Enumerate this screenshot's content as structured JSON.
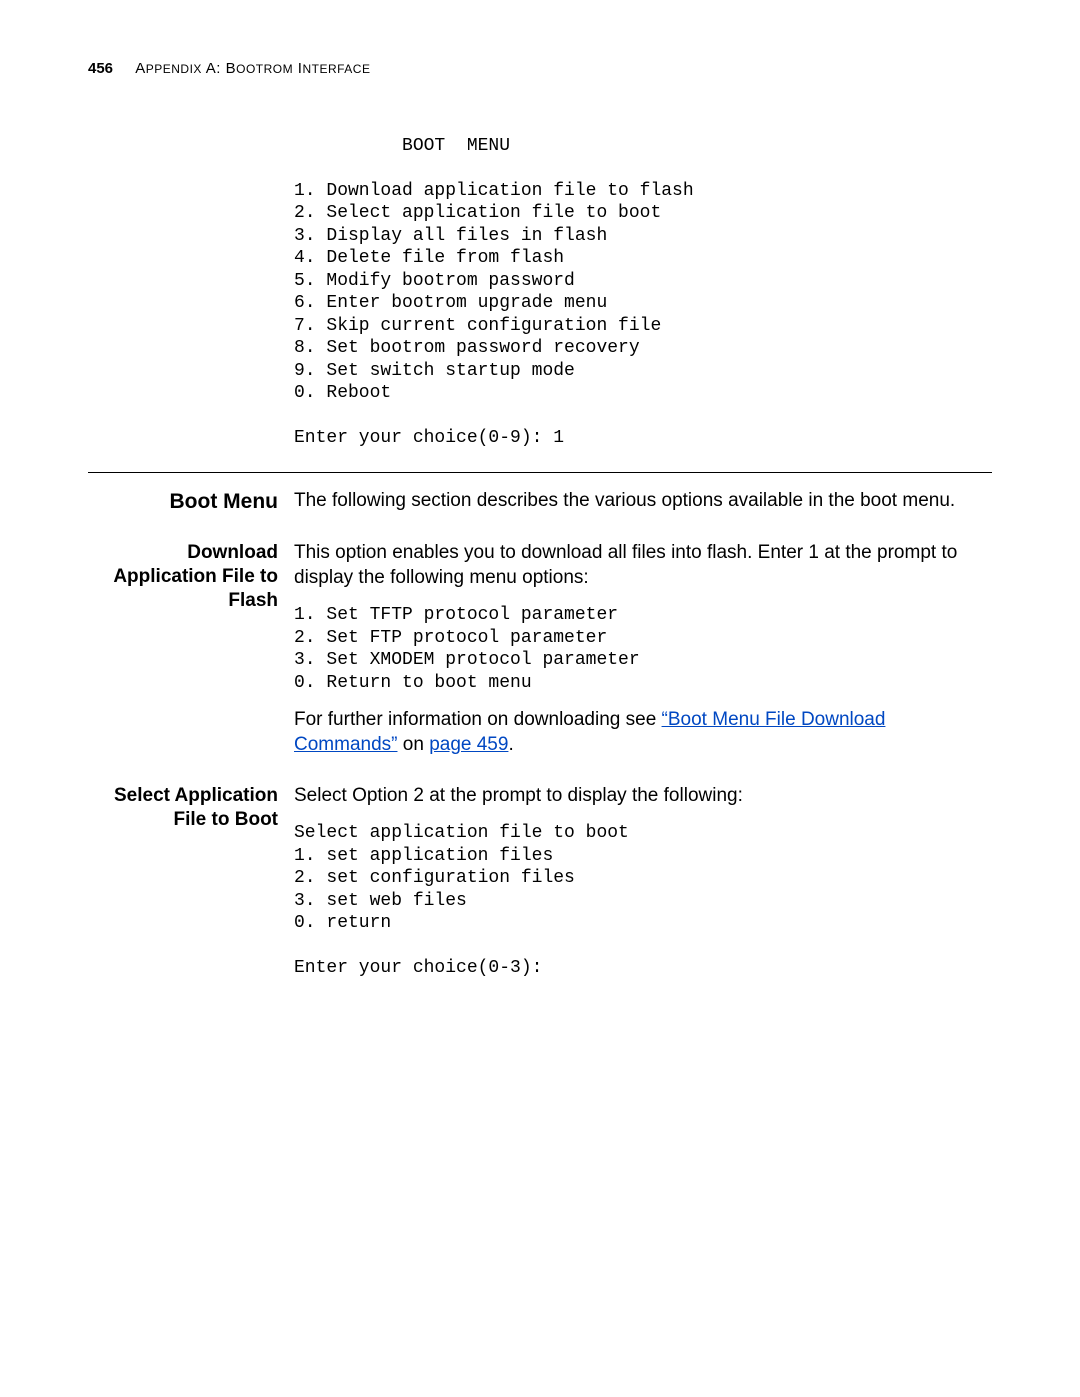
{
  "header": {
    "page_number": "456",
    "appendix_prefix": "A",
    "appendix_rest": "PPENDIX",
    "appendix_letter": "A:",
    "title_prefix": "B",
    "title_rest": "OOTROM",
    "title2_prefix": "I",
    "title2_rest": "NTERFACE"
  },
  "boot_menu_block": "          BOOT  MENU\n\n1. Download application file to flash\n2. Select application file to boot\n3. Display all files in flash\n4. Delete file from flash\n5. Modify bootrom password\n6. Enter bootrom upgrade menu\n7. Skip current configuration file\n8. Set bootrom password recovery\n9. Set switch startup mode\n0. Reboot\n\nEnter your choice(0-9): 1",
  "boot_menu": {
    "heading": "Boot Menu",
    "intro": "The following section describes the various options available in the boot menu."
  },
  "download": {
    "heading": "Download Application File to Flash",
    "intro": "This option enables you to download all files into flash. Enter 1 at the prompt to display the following menu options:",
    "menu": "1. Set TFTP protocol parameter\n2. Set FTP protocol parameter\n3. Set XMODEM protocol parameter\n0. Return to boot menu",
    "tail_pre": "For further information on downloading see ",
    "link1": "“Boot Menu File Download Commands”",
    "tail_mid": " on ",
    "link2": "page 459",
    "tail_post": "."
  },
  "select_app": {
    "heading": "Select Application File to Boot",
    "intro": "Select Option 2 at the prompt to display the following:",
    "menu": "Select application file to boot\n1. set application files\n2. set configuration files\n3. set web files\n0. return\n\nEnter your choice(0-3):"
  }
}
